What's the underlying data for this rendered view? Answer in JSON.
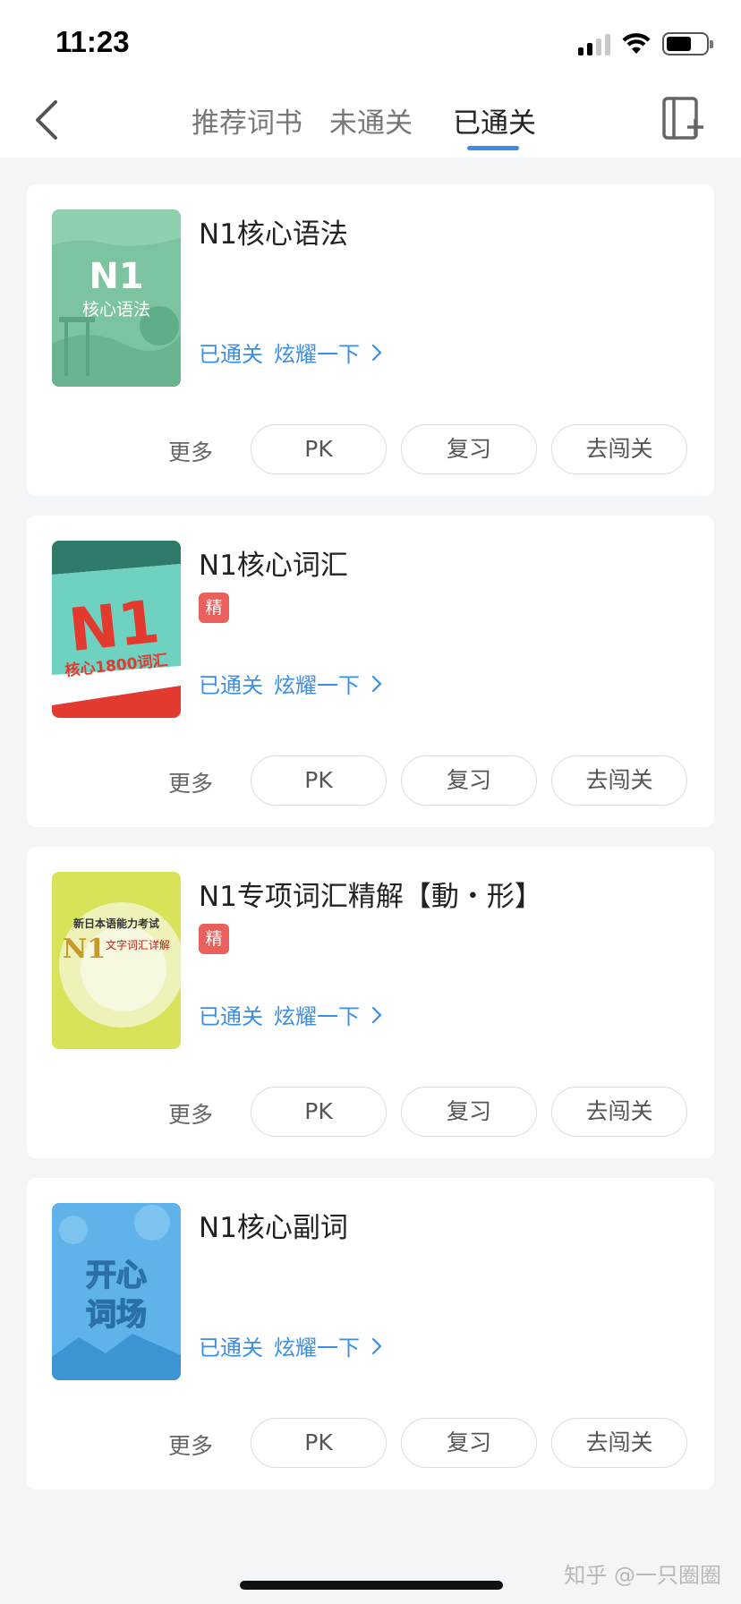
{
  "status_bar": {
    "time": "11:23"
  },
  "nav": {
    "tabs": [
      {
        "label": "推荐词书"
      },
      {
        "label": "未通关"
      },
      {
        "label": "已通关"
      }
    ],
    "active_tab": "已通关"
  },
  "books": [
    {
      "title": "N1核心语法",
      "premium": false,
      "cover_text_1": "N1",
      "cover_text_2": "核心语法",
      "status": "已通关",
      "share": "炫耀一下",
      "more": "更多",
      "pk": "PK",
      "review": "复习",
      "challenge": "去闯关"
    },
    {
      "title": "N1核心词汇",
      "premium": true,
      "badge": "精",
      "cover_text_1": "N1",
      "cover_text_2": "核心1800词汇",
      "status": "已通关",
      "share": "炫耀一下",
      "more": "更多",
      "pk": "PK",
      "review": "复习",
      "challenge": "去闯关"
    },
    {
      "title": "N1专项词汇精解【動・形】",
      "premium": true,
      "badge": "精",
      "cover_text_1": "新日本语能力考试",
      "cover_text_2": "N1",
      "cover_text_3": "文字词汇详解",
      "status": "已通关",
      "share": "炫耀一下",
      "more": "更多",
      "pk": "PK",
      "review": "复习",
      "challenge": "去闯关"
    },
    {
      "title": "N1核心副词",
      "premium": false,
      "cover_text_1": "开心",
      "cover_text_2": "词场",
      "status": "已通关",
      "share": "炫耀一下",
      "more": "更多",
      "pk": "PK",
      "review": "复习",
      "challenge": "去闯关"
    }
  ],
  "watermark": "知乎 @一只圈圈",
  "colors": {
    "accent": "#3a8ee6",
    "badge": "#e9605c",
    "background": "#f3f6f9"
  }
}
